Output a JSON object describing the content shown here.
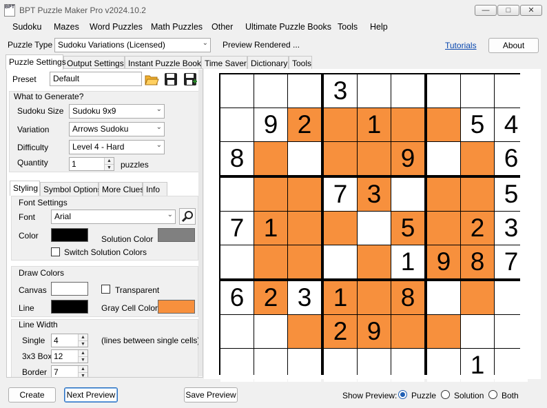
{
  "window": {
    "title": "BPT Puzzle Maker Pro v2024.10.2",
    "icon_text": "BPT"
  },
  "menu": [
    "Sudoku",
    "Mazes",
    "Word Puzzles",
    "Math Puzzles",
    "Other",
    "Ultimate Puzzle Books",
    "Tools",
    "Help"
  ],
  "toolbar": {
    "puzzle_type_label": "Puzzle Type",
    "puzzle_type_value": "Sudoku Variations (Licensed)",
    "status": "Preview Rendered ...",
    "tutorials_link": "Tutorials",
    "about_button": "About"
  },
  "main_tabs": [
    "Puzzle Settings",
    "Output Settings",
    "Instant Puzzle Books",
    "Time Saver",
    "Dictionary",
    "Tools"
  ],
  "settings": {
    "preset_label": "Preset",
    "preset_value": "Default",
    "what_to_generate": "What to Generate?",
    "size_label": "Sudoku Size",
    "size_value": "Sudoku  9x9",
    "variation_label": "Variation",
    "variation_value": "Arrows Sudoku",
    "difficulty_label": "Difficulty",
    "difficulty_value": "Level 4 - Hard",
    "quantity_label": "Quantity",
    "quantity_value": "1",
    "quantity_unit": "puzzles"
  },
  "sub_tabs": [
    "Styling",
    "Symbol Options",
    "More Clues",
    "Info"
  ],
  "styling": {
    "font_settings": "Font Settings",
    "font_label": "Font",
    "font_value": "Arial",
    "color_label": "Color",
    "solution_color_label": "Solution Color",
    "switch_solution_colors": "Switch Solution Colors",
    "draw_colors": "Draw Colors",
    "canvas_label": "Canvas",
    "transparent_label": "Transparent",
    "line_label": "Line",
    "gray_cell_color_label": "Gray Cell Color",
    "line_width": "Line Width",
    "single_label": "Single",
    "single_value": "4",
    "single_note": "(lines between single cells)",
    "box_label": "3x3 Box",
    "box_value": "12",
    "border_label": "Border",
    "border_value": "7",
    "colors": {
      "font": "#000000",
      "solution": "#808080",
      "canvas": "#ffffff",
      "line": "#000000",
      "gray_cell": "#f7903d"
    }
  },
  "puzzle": {
    "grid": [
      [
        "",
        "",
        "",
        "3",
        "",
        "",
        "",
        "",
        ""
      ],
      [
        "",
        "9",
        "2",
        "",
        "1",
        "",
        "",
        "5",
        "4"
      ],
      [
        "8",
        "",
        "",
        "",
        "",
        "9",
        "",
        "",
        "6"
      ],
      [
        "",
        "",
        "",
        "7",
        "3",
        "",
        "",
        "",
        "5"
      ],
      [
        "7",
        "1",
        "",
        "",
        "",
        "5",
        "",
        "2",
        "3"
      ],
      [
        "",
        "",
        "",
        "",
        "",
        "1",
        "9",
        "8",
        "7"
      ],
      [
        "6",
        "2",
        "3",
        "1",
        "",
        "8",
        "",
        "",
        ""
      ],
      [
        "",
        "",
        "",
        "2",
        "9",
        "",
        "",
        "",
        ""
      ],
      [
        "",
        "",
        "",
        "",
        "",
        "",
        "",
        "1",
        ""
      ]
    ],
    "gray": [
      [
        0,
        0,
        0,
        0,
        0,
        0,
        0,
        0,
        0
      ],
      [
        0,
        0,
        1,
        1,
        1,
        1,
        1,
        0,
        0
      ],
      [
        0,
        1,
        0,
        1,
        1,
        1,
        0,
        1,
        0
      ],
      [
        0,
        1,
        1,
        0,
        1,
        0,
        1,
        1,
        0
      ],
      [
        0,
        1,
        1,
        1,
        0,
        1,
        1,
        1,
        0
      ],
      [
        0,
        1,
        1,
        0,
        1,
        0,
        1,
        1,
        0
      ],
      [
        0,
        1,
        0,
        1,
        1,
        1,
        0,
        1,
        0
      ],
      [
        0,
        0,
        1,
        1,
        1,
        1,
        1,
        0,
        0
      ],
      [
        0,
        0,
        0,
        0,
        0,
        0,
        0,
        0,
        0
      ]
    ]
  },
  "bottom": {
    "create": "Create",
    "next_preview": "Next Preview",
    "save_preview": "Save Preview",
    "show_preview_label": "Show Preview:",
    "options": [
      "Puzzle",
      "Solution",
      "Both"
    ],
    "selected": "Puzzle"
  }
}
